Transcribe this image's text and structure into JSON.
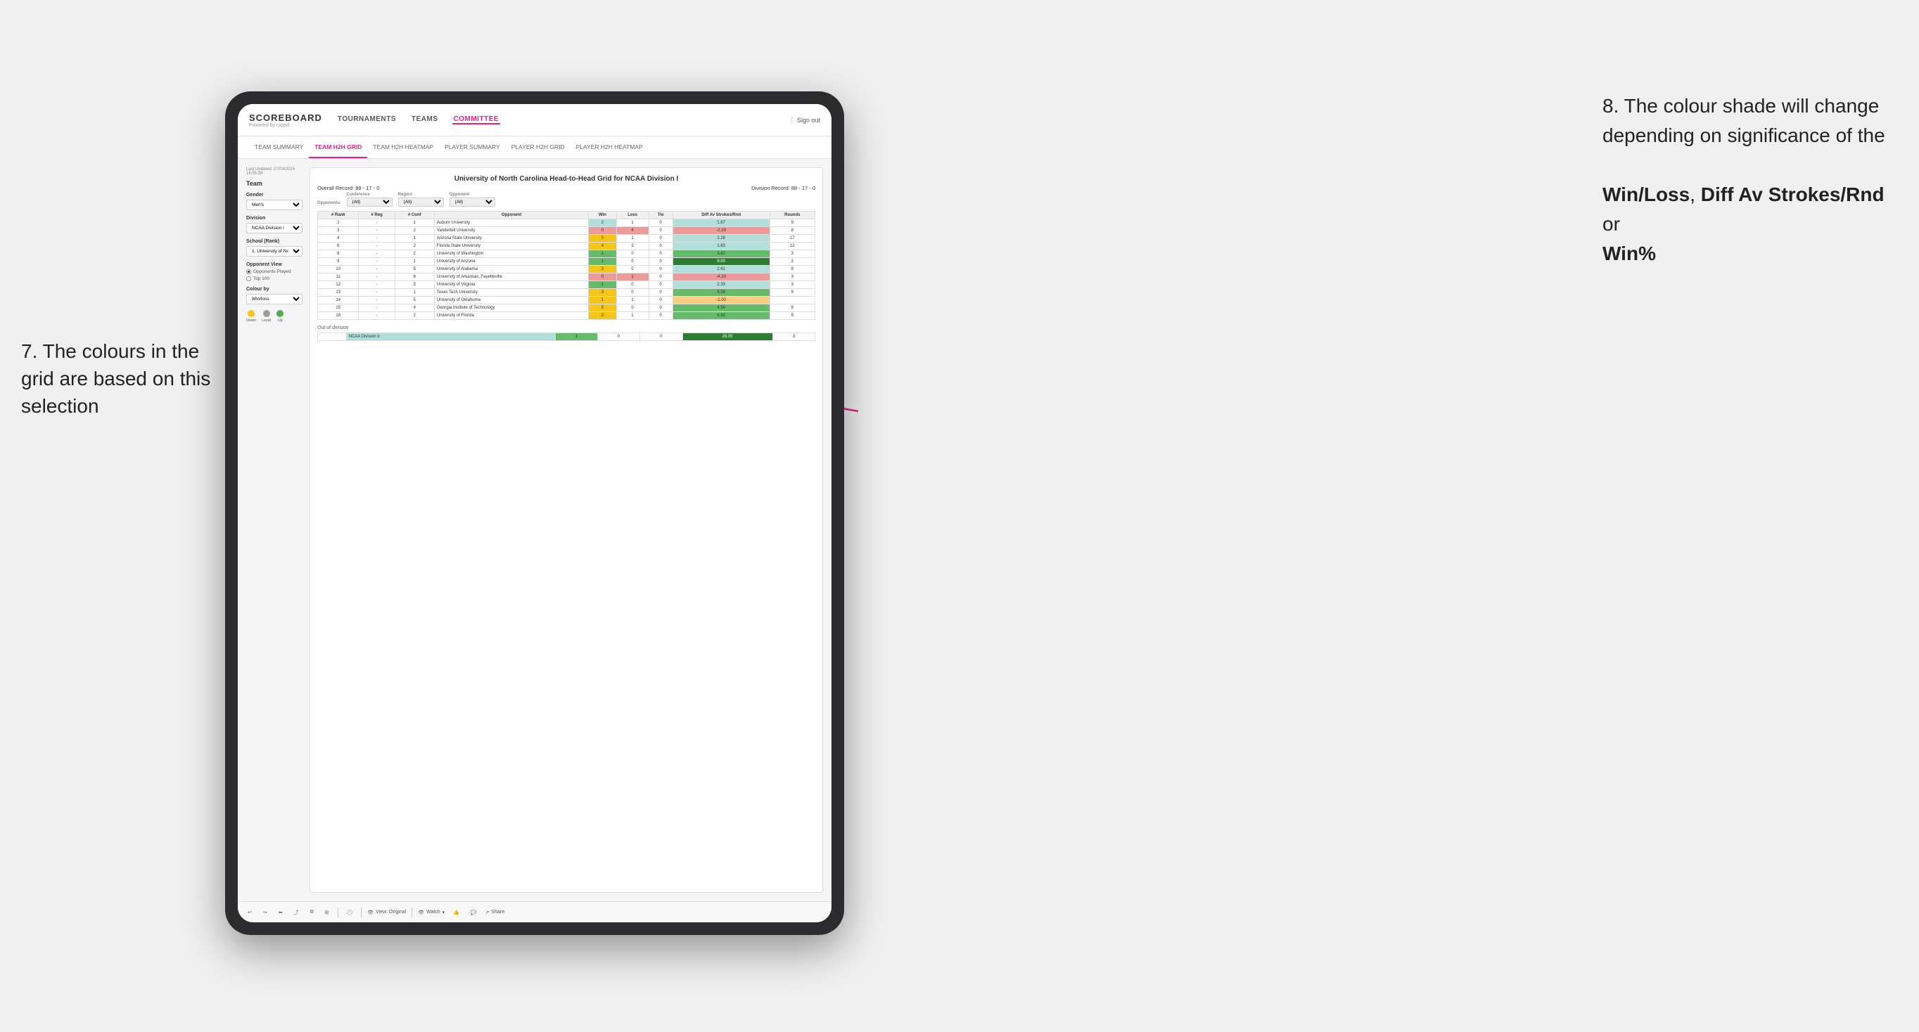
{
  "annotations": {
    "left_title": "7. The colours in the grid are based on this selection",
    "right_title": "8. The colour shade will change depending on significance of the",
    "right_bold1": "Win/Loss",
    "right_sep1": ", ",
    "right_bold2": "Diff Av Strokes/Rnd",
    "right_sep2": " or",
    "right_bold3": "Win%"
  },
  "header": {
    "logo": "SCOREBOARD",
    "logo_sub": "Powered by clippd",
    "nav": [
      "TOURNAMENTS",
      "TEAMS",
      "COMMITTEE"
    ],
    "sign_out": "Sign out"
  },
  "sub_nav": {
    "items": [
      "TEAM SUMMARY",
      "TEAM H2H GRID",
      "TEAM H2H HEATMAP",
      "PLAYER SUMMARY",
      "PLAYER H2H GRID",
      "PLAYER H2H HEATMAP"
    ],
    "active": "TEAM H2H GRID"
  },
  "sidebar": {
    "last_updated_label": "Last Updated: 27/03/2024",
    "last_updated_time": "16:55:38",
    "team_title": "Team",
    "gender_label": "Gender",
    "gender_value": "Men's",
    "division_label": "Division",
    "division_value": "NCAA Division I",
    "school_label": "School (Rank)",
    "school_value": "1. University of Nort...",
    "opponent_view_label": "Opponent View",
    "opponent_options": [
      "Opponents Played",
      "Top 100"
    ],
    "colour_by_label": "Colour by",
    "colour_by_value": "Win/loss",
    "legend": {
      "down_label": "Down",
      "down_color": "#f5c518",
      "level_label": "Level",
      "level_color": "#9e9e9e",
      "up_label": "Up",
      "up_color": "#4caf50"
    }
  },
  "grid": {
    "title": "University of North Carolina Head-to-Head Grid for NCAA Division I",
    "overall_record_label": "Overall Record:",
    "overall_record": "89 - 17 - 0",
    "division_record_label": "Division Record:",
    "division_record": "88 - 17 - 0",
    "filters": {
      "conference_label": "Conference",
      "conference_value": "(All)",
      "region_label": "Region",
      "region_value": "(All)",
      "opponent_label": "Opponent",
      "opponent_value": "(All)",
      "opponents_label": "Opponents:"
    },
    "columns": [
      "#\nRank",
      "#\nReg",
      "#\nConf",
      "Opponent",
      "Win",
      "Loss",
      "Tie",
      "Diff Av\nStrokes/Rnd",
      "Rounds"
    ],
    "rows": [
      {
        "rank": "2",
        "reg": "-",
        "conf": "1",
        "opponent": "Auburn University",
        "win": "2",
        "loss": "1",
        "tie": "0",
        "diff": "1.67",
        "rounds": "9",
        "win_color": "light-green",
        "diff_color": "light-green"
      },
      {
        "rank": "3",
        "reg": "-",
        "conf": "2",
        "opponent": "Vanderbilt University",
        "win": "0",
        "loss": "4",
        "tie": "0",
        "diff": "-2.29",
        "rounds": "8",
        "win_color": "red",
        "diff_color": "red"
      },
      {
        "rank": "4",
        "reg": "-",
        "conf": "1",
        "opponent": "Arizona State University",
        "win": "5",
        "loss": "1",
        "tie": "0",
        "diff": "2.28",
        "rounds": "17",
        "win_color": "yellow",
        "diff_color": "light-green"
      },
      {
        "rank": "6",
        "reg": "-",
        "conf": "2",
        "opponent": "Florida State University",
        "win": "4",
        "loss": "3",
        "tie": "0",
        "diff": "1.83",
        "rounds": "12",
        "win_color": "yellow",
        "diff_color": "light-green"
      },
      {
        "rank": "8",
        "reg": "-",
        "conf": "2",
        "opponent": "University of Washington",
        "win": "1",
        "loss": "0",
        "tie": "0",
        "diff": "3.67",
        "rounds": "3",
        "win_color": "green",
        "diff_color": "green"
      },
      {
        "rank": "9",
        "reg": "-",
        "conf": "1",
        "opponent": "University of Arizona",
        "win": "1",
        "loss": "0",
        "tie": "0",
        "diff": "9.00",
        "rounds": "2",
        "win_color": "green",
        "diff_color": "dark-green"
      },
      {
        "rank": "10",
        "reg": "-",
        "conf": "5",
        "opponent": "University of Alabama",
        "win": "3",
        "loss": "0",
        "tie": "0",
        "diff": "2.61",
        "rounds": "8",
        "win_color": "yellow",
        "diff_color": "light-green"
      },
      {
        "rank": "11",
        "reg": "-",
        "conf": "6",
        "opponent": "University of Arkansas, Fayetteville",
        "win": "0",
        "loss": "1",
        "tie": "0",
        "diff": "-4.33",
        "rounds": "3",
        "win_color": "red",
        "diff_color": "red"
      },
      {
        "rank": "12",
        "reg": "-",
        "conf": "3",
        "opponent": "University of Virginia",
        "win": "1",
        "loss": "0",
        "tie": "0",
        "diff": "2.33",
        "rounds": "3",
        "win_color": "green",
        "diff_color": "light-green"
      },
      {
        "rank": "13",
        "reg": "-",
        "conf": "1",
        "opponent": "Texas Tech University",
        "win": "3",
        "loss": "0",
        "tie": "0",
        "diff": "5.56",
        "rounds": "9",
        "win_color": "yellow",
        "diff_color": "green"
      },
      {
        "rank": "14",
        "reg": "-",
        "conf": "5",
        "opponent": "University of Oklahoma",
        "win": "1",
        "loss": "1",
        "tie": "0",
        "diff": "-1.00",
        "rounds": "",
        "win_color": "yellow",
        "diff_color": "orange"
      },
      {
        "rank": "15",
        "reg": "-",
        "conf": "4",
        "opponent": "Georgia Institute of Technology",
        "win": "5",
        "loss": "0",
        "tie": "0",
        "diff": "4.50",
        "rounds": "9",
        "win_color": "yellow",
        "diff_color": "green"
      },
      {
        "rank": "16",
        "reg": "-",
        "conf": "2",
        "opponent": "University of Florida",
        "win": "3",
        "loss": "1",
        "tie": "0",
        "diff": "6.62",
        "rounds": "9",
        "win_color": "yellow",
        "diff_color": "green"
      }
    ],
    "out_of_division_label": "Out of division",
    "out_of_division_row": {
      "division": "NCAA Division II",
      "win": "1",
      "loss": "0",
      "tie": "0",
      "diff": "26.00",
      "rounds": "3",
      "diff_color": "dark-green"
    }
  },
  "toolbar": {
    "view_label": "View: Original",
    "watch_label": "Watch",
    "share_label": "Share"
  }
}
